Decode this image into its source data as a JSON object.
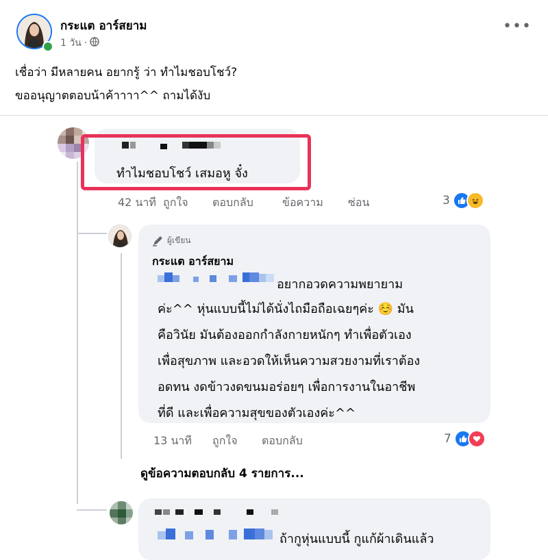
{
  "post": {
    "author": "กระแต อาร์สยาม",
    "time": "1 วัน",
    "separator": "·",
    "more_label": "•••",
    "lines": [
      "เชื่อว่า มีหลายคน อยากรู้ ว่า ทำไมชอบโชว์?",
      "ขออนุญาตตอบน้าค้าาาา^^ ถามได้งับ"
    ]
  },
  "comment1": {
    "text": "ทำไมชอบโชว์   เสมอหู จั๋ง",
    "time": "42 นาที",
    "like": "ถูกใจ",
    "reply": "ตอบกลับ",
    "message": "ข้อความ",
    "hide": "ซ่อน",
    "reaction_count": "3",
    "highlight_color": "#e8325a"
  },
  "reply1": {
    "badge": "ผู้เขียน",
    "author": "กระแต อาร์สยาม",
    "lines": [
      "อยากอวดความพยายาม",
      "ค่ะ^^ หุ่นแบบนี้ไม่ได้นั่งไถมือถือเฉยๆค่ะ ☺️ มัน",
      "คือวินัย มันต้องออกกำลังกายหนักๆ  ทำเพื่อตัวเอง",
      "เพื่อสุขภาพ และอวดให้เห็นความสวยงามที่เราต้อง",
      "อดทน งดข้าวงดขนมอร่อยๆ เพื่อการงานในอาชีพ",
      "ที่ดี และเพื่อความสุขของตัวเองค่ะ^^"
    ],
    "time": "13 นาที",
    "like": "ถูกใจ",
    "reply": "ตอบกลับ",
    "reaction_count": "7"
  },
  "see_more": "ดูข้อความตอบกลับ 4 รายการ...",
  "comment2": {
    "text": "ถ้ากูหุ่นแบบนี้ กูแก้ผ้าเดินแล้ว"
  },
  "colors": {
    "like_blue": "#1877f2",
    "love_red": "#f33e58",
    "haha_yellow": "#f7b928",
    "online_green": "#31a24c"
  }
}
